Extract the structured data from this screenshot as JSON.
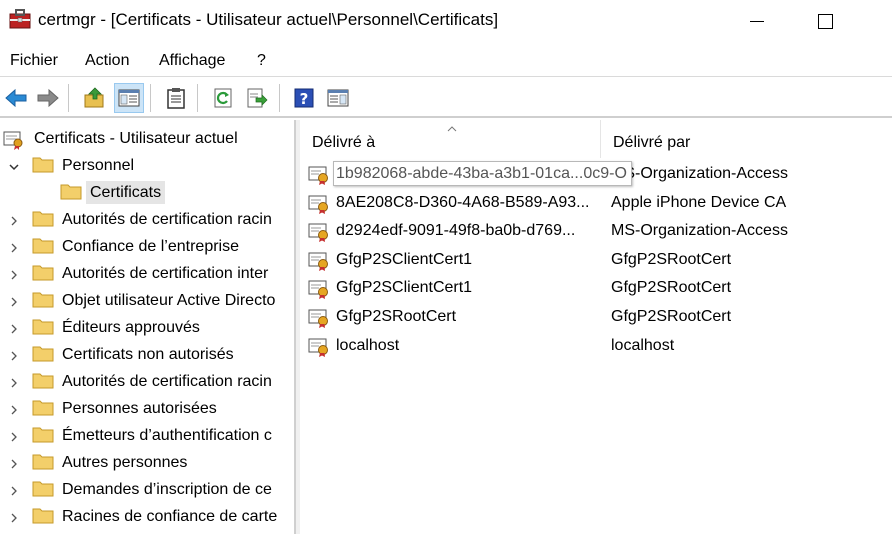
{
  "window": {
    "title": "certmgr - [Certificats - Utilisateur actuel\\Personnel\\Certificats]"
  },
  "menu": [
    "Fichier",
    "Action",
    "Affichage",
    "?"
  ],
  "toolbar": {
    "buttons": [
      "back-arrow-icon",
      "forward-arrow-icon",
      "up-folder-icon",
      "show-hide-tree-icon",
      "clipboard-icon",
      "refresh-icon",
      "export-list-icon",
      "help-icon",
      "properties-icon"
    ]
  },
  "tree": {
    "root": "Certificats - Utilisateur actuel",
    "personnel": "Personnel",
    "selected": "Certificats",
    "items": [
      "Autorités de certification racin",
      "Confiance de l’entreprise",
      "Autorités de certification inter",
      "Objet utilisateur Active Directo",
      "Éditeurs approuvés",
      "Certificats non autorisés",
      "Autorités de certification racin",
      "Personnes autorisées",
      "Émetteurs d’authentification c",
      "Autres personnes",
      "Demandes d’inscription de ce",
      "Racines de confiance de carte"
    ]
  },
  "list": {
    "headers": [
      "Délivré à",
      "Délivré par"
    ],
    "rows": [
      {
        "issued_to": "1b982068-abde-43ba-a3b1-01ca",
        "issued_by": "MS-Organization-Access"
      },
      {
        "issued_to": "8AE208C8-D360-4A68-B589-A93...",
        "issued_by": "Apple iPhone Device CA"
      },
      {
        "issued_to": "d2924edf-9091-49f8-ba0b-d769...",
        "issued_by": "MS-Organization-Access"
      },
      {
        "issued_to": "GfgP2SClientCert1",
        "issued_by": "GfgP2SRootCert"
      },
      {
        "issued_to": "GfgP2SClientCert1",
        "issued_by": "GfgP2SRootCert"
      },
      {
        "issued_to": "GfgP2SRootCert",
        "issued_by": "GfgP2SRootCert"
      },
      {
        "issued_to": "localhost",
        "issued_by": "localhost"
      }
    ],
    "tooltip": "1b982068-abde-43ba-a3b1-01ca...0c9-O"
  },
  "colors": {
    "selection": "#e5e5e5",
    "pressed_button": "#cce4f7",
    "folder": "#f3cf6a"
  }
}
